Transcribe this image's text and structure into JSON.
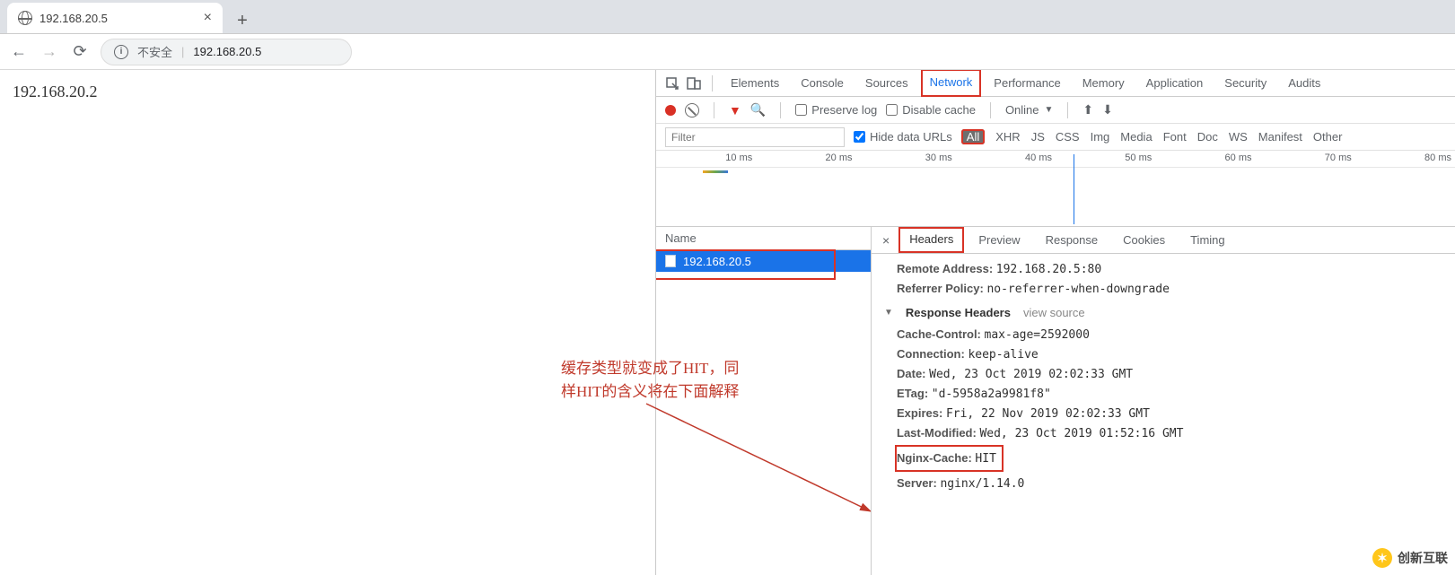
{
  "tab": {
    "title": "192.168.20.5"
  },
  "address": {
    "not_secure": "不安全",
    "url": "192.168.20.5"
  },
  "page": {
    "content": "192.168.20.2"
  },
  "annotation": {
    "line1": "缓存类型就变成了HIT，同",
    "line2": "样HIT的含义将在下面解释"
  },
  "devtools": {
    "tabs": [
      "Elements",
      "Console",
      "Sources",
      "Network",
      "Performance",
      "Memory",
      "Application",
      "Security",
      "Audits"
    ],
    "active_tab": "Network",
    "toolbar": {
      "preserve_log": "Preserve log",
      "disable_cache": "Disable cache",
      "throttle": "Online"
    },
    "filter": {
      "placeholder": "Filter",
      "hide_data_urls": "Hide data URLs",
      "types": [
        "All",
        "XHR",
        "JS",
        "CSS",
        "Img",
        "Media",
        "Font",
        "Doc",
        "WS",
        "Manifest",
        "Other"
      ]
    },
    "timeline_labels": [
      "10 ms",
      "20 ms",
      "30 ms",
      "40 ms",
      "50 ms",
      "60 ms",
      "70 ms",
      "80 ms"
    ],
    "requests": {
      "col_name": "Name",
      "items": [
        "192.168.20.5"
      ]
    },
    "detail": {
      "tabs": [
        "Headers",
        "Preview",
        "Response",
        "Cookies",
        "Timing"
      ],
      "active": "Headers",
      "remote_address_label": "Remote Address:",
      "remote_address": "192.168.20.5:80",
      "referrer_policy_label": "Referrer Policy:",
      "referrer_policy": "no-referrer-when-downgrade",
      "response_headers": "Response Headers",
      "view_source": "view source",
      "headers": {
        "cache_control_label": "Cache-Control:",
        "cache_control": "max-age=2592000",
        "connection_label": "Connection:",
        "connection": "keep-alive",
        "date_label": "Date:",
        "date": "Wed, 23 Oct 2019 02:02:33 GMT",
        "etag_label": "ETag:",
        "etag": "\"d-5958a2a9981f8\"",
        "expires_label": "Expires:",
        "expires": "Fri, 22 Nov 2019 02:02:33 GMT",
        "last_modified_label": "Last-Modified:",
        "last_modified": "Wed, 23 Oct 2019 01:52:16 GMT",
        "nginx_cache_label": "Nginx-Cache:",
        "nginx_cache": "HIT",
        "server_label": "Server:",
        "server": "nginx/1.14.0"
      }
    }
  },
  "watermark": "创新互联"
}
